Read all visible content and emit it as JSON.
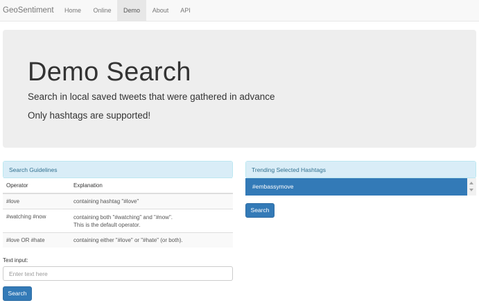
{
  "navbar": {
    "brand": "GeoSentiment",
    "items": [
      {
        "label": "Home"
      },
      {
        "label": "Online"
      },
      {
        "label": "Demo"
      },
      {
        "label": "About"
      },
      {
        "label": "API"
      }
    ],
    "active": "Demo"
  },
  "jumbotron": {
    "title": "Demo Search",
    "line1": "Search in local saved tweets that were gathered in advance",
    "line2": "Only hashtags are supported!"
  },
  "guidelines": {
    "heading": "Search Guidelines",
    "columns": [
      "Operator",
      "Explanation"
    ],
    "rows": [
      {
        "operator": "#love",
        "explanation": "containing hashtag \"#love\""
      },
      {
        "operator": "#watching #now",
        "explanation": "containing both \"#watching\" and \"#now\".",
        "explanation2": "This is the default operator."
      },
      {
        "operator": "#love OR #hate",
        "explanation": "containing either \"#love\" or \"#hate\" (or both)."
      }
    ]
  },
  "text_input": {
    "label": "Text input:",
    "placeholder": "Enter text here",
    "value": ""
  },
  "left_search_button": "Search",
  "trending": {
    "heading": "Trending Selected Hashtags",
    "items": [
      "#embassymove"
    ],
    "selected": "#embassymove"
  },
  "right_search_button": "Search",
  "colors": {
    "primary": "#337ab7",
    "panel_heading_bg": "#d9edf7",
    "panel_heading_text": "#31708f",
    "jumbotron_bg": "#eeeeee",
    "navbar_bg": "#f8f8f8"
  }
}
